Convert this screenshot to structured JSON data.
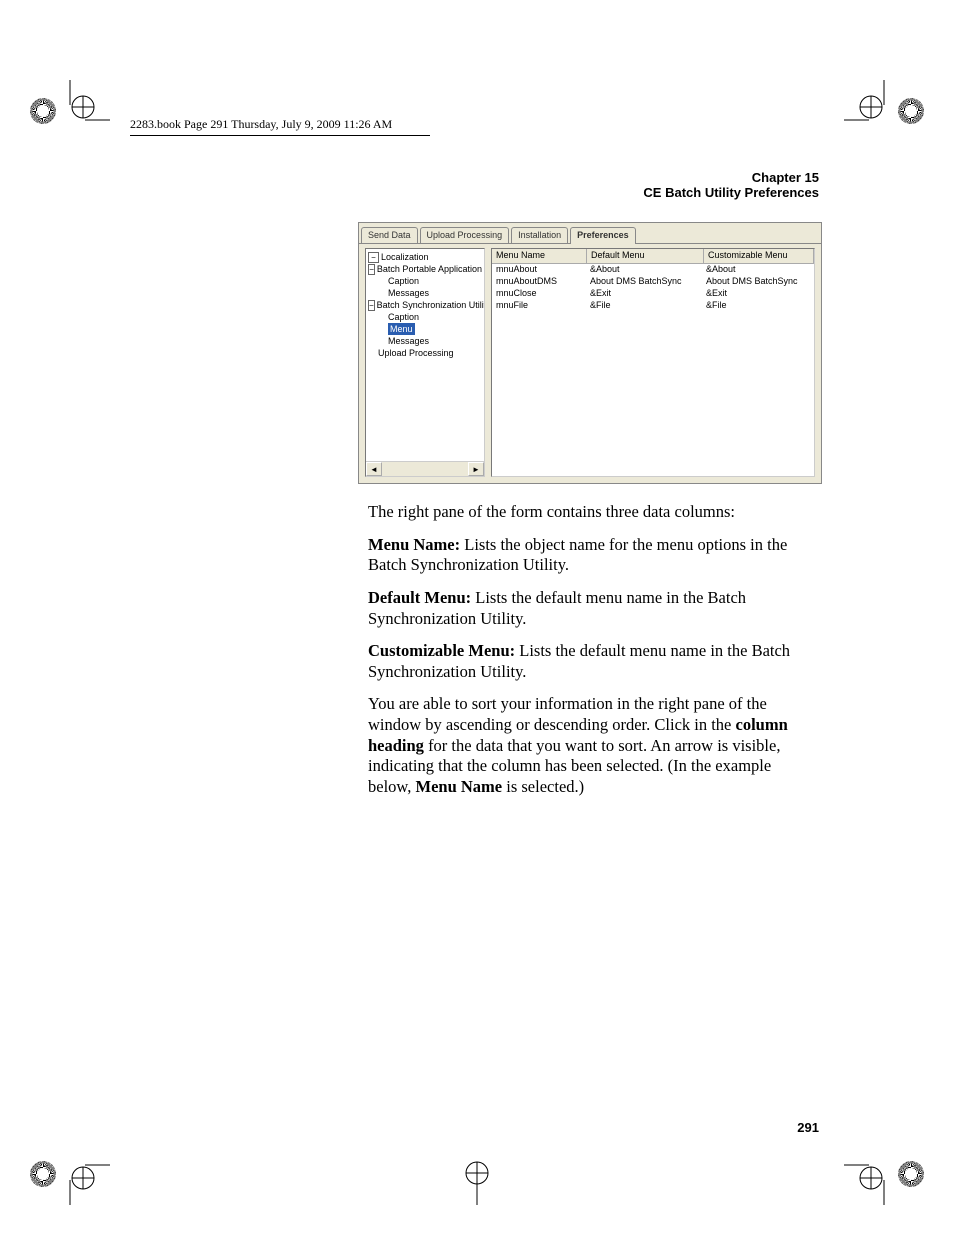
{
  "book_header": "2283.book  Page 291  Thursday, July 9, 2009  11:26 AM",
  "page_header": {
    "chapter": "Chapter 15",
    "title": "CE Batch Utility Preferences"
  },
  "screenshot": {
    "tabs": [
      "Send Data",
      "Upload Processing",
      "Installation",
      "Preferences"
    ],
    "active_tab": "Preferences",
    "tree": {
      "root": "Localization",
      "group1": "Batch Portable Application",
      "g1_items": [
        "Caption",
        "Messages"
      ],
      "group2": "Batch Synchronization Utility",
      "g2_items": [
        "Caption",
        "Menu",
        "Messages"
      ],
      "selected": "Menu",
      "item_last": "Upload Processing"
    },
    "columns": [
      "Menu Name",
      "Default Menu",
      "Customizable Menu"
    ],
    "rows": [
      {
        "a": "mnuAbout",
        "b": "&About",
        "c": "&About"
      },
      {
        "a": "mnuAboutDMS",
        "b": "About DMS BatchSync",
        "c": "About DMS BatchSync"
      },
      {
        "a": "mnuClose",
        "b": "&Exit",
        "c": "&Exit"
      },
      {
        "a": "mnuFile",
        "b": "&File",
        "c": "&File"
      }
    ],
    "scroll_left": "◄",
    "scroll_right": "►",
    "box_minus": "−"
  },
  "body": {
    "p1": "The right pane of the form contains three data columns:",
    "p2a": "Menu Name:",
    "p2b": " Lists the object name for the menu options in the Batch Synchronization Utility.",
    "p3a": "Default Menu:",
    "p3b": " Lists the default menu name in the Batch Synchroniza­tion Utility.",
    "p4a": "Customizable Menu:",
    "p4b": " Lists the default menu name in the Batch Syn­chronization Utility.",
    "p5a": "You are able to sort your information in the right pane of the window by ascending or descending order. Click in the ",
    "p5b": "column heading",
    "p5c": " for the data that you want to sort. An arrow is visible, indicating that the col­umn has been selected. (In the example below, ",
    "p5d": "Menu Name",
    "p5e": " is selected.)"
  },
  "page_number": "291"
}
